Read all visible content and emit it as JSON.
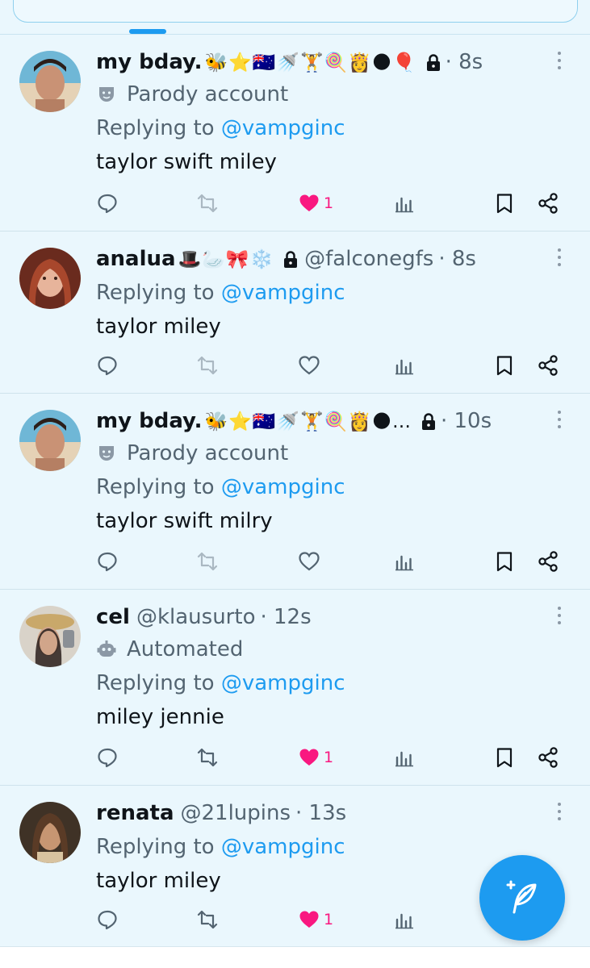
{
  "colors": {
    "accent": "#1d9bf0",
    "like": "#f91880",
    "muted": "#536471",
    "background": "#eaf7fd"
  },
  "tweets": [
    {
      "name": "my bday.",
      "emojis": "🐝⭐🇦🇺🚿🏋️🍭👸🌑🎈",
      "handle": "",
      "time": "· 8s",
      "badge": "Parody account",
      "badge_icon": "parody-mask-icon",
      "reply_prefix": "Replying to ",
      "reply_to": "@vampginc",
      "text": "taylor swift miley",
      "liked": true,
      "like_count": "1"
    },
    {
      "name": "analua",
      "emojis": "🎩🦢🎀❄️",
      "handle": "@falconegfs",
      "time": "· 8s",
      "badge": "",
      "badge_icon": "",
      "reply_prefix": "Replying to ",
      "reply_to": "@vampginc",
      "text": "taylor miley",
      "liked": false,
      "like_count": ""
    },
    {
      "name": "my bday.",
      "emojis": "🐝⭐🇦🇺🚿🏋️🍭👸🌑…",
      "handle": "",
      "time": "· 10s",
      "badge": "Parody account",
      "badge_icon": "parody-mask-icon",
      "reply_prefix": "Replying to ",
      "reply_to": "@vampginc",
      "text": "taylor swift milry",
      "liked": false,
      "like_count": ""
    },
    {
      "name": "cel",
      "emojis": "",
      "handle": "@klausurto",
      "time": "· 12s",
      "badge": "Automated",
      "badge_icon": "robot-icon",
      "reply_prefix": "Replying to ",
      "reply_to": "@vampginc",
      "text": "miley jennie",
      "liked": true,
      "like_count": "1"
    },
    {
      "name": "renata",
      "emojis": "",
      "handle": "@21lupins",
      "time": "· 13s",
      "badge": "",
      "badge_icon": "",
      "reply_prefix": "Replying to ",
      "reply_to": "@vampginc",
      "text": "taylor miley",
      "liked": true,
      "like_count": "1"
    }
  ]
}
